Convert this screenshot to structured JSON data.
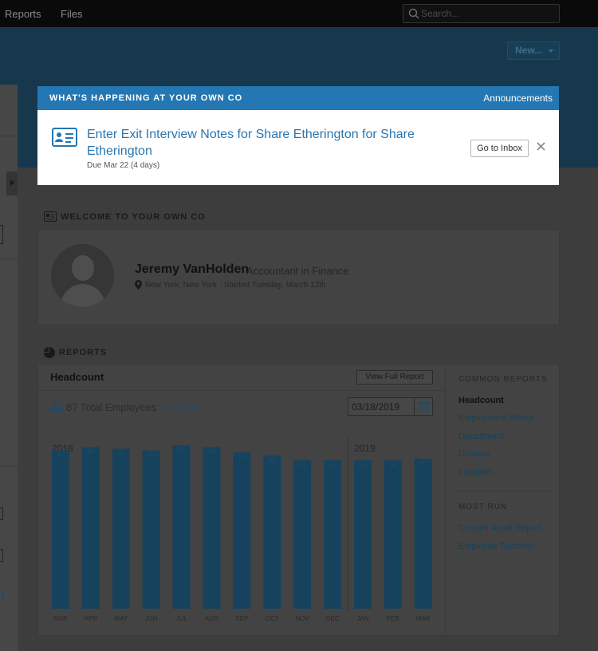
{
  "topnav": {
    "links": [
      "Reports",
      "Files"
    ],
    "search_placeholder": "Search..."
  },
  "header": {
    "new_button": "New..."
  },
  "welcome": {
    "section_title": "WELCOME TO YOUR OWN CO",
    "name": "Jeremy VanHolden",
    "title": "Accountant in Finance",
    "location": "New York, New York · Started Tuesday, March 12th"
  },
  "reports": {
    "section_title": "REPORTS",
    "card_title": "Headcount",
    "view_full_report": "View Full Report",
    "total_employees": "87 Total Employees",
    "ytd": "+ 1 YTD",
    "date_value": "03/18/2019",
    "year_left": "2018",
    "year_right": "2019"
  },
  "chart_data": {
    "type": "bar",
    "categories": [
      "MAR",
      "APR",
      "MAY",
      "JUN",
      "JUL",
      "AUG",
      "SEP",
      "OCT",
      "NOV",
      "DEC",
      "JAN",
      "FEB",
      "MAR"
    ],
    "values": [
      92,
      94,
      93,
      92,
      95,
      94,
      91,
      89,
      86,
      86,
      86,
      86,
      87
    ],
    "ylim": [
      0,
      100
    ],
    "colors": {
      "bar": "#17425e",
      "label": "#1f4b66"
    }
  },
  "common_reports": {
    "heading": "COMMON REPORTS",
    "items": [
      "Headcount",
      "Employment Status",
      "Department",
      "Division",
      "Location"
    ],
    "active": "Headcount"
  },
  "most_run": {
    "heading": "MOST RUN",
    "items": [
      "Custom Asset Report",
      "Employee Turnover"
    ]
  },
  "announcement": {
    "header_title": "WHAT'S HAPPENING AT YOUR OWN CO",
    "header_link": "Announcements",
    "task": "Enter Exit Interview Notes for Share Etherington for Share Etherington",
    "due": "Due Mar 22 (4 days)",
    "inbox_button": "Go to Inbox"
  },
  "colors": {
    "accent": "#2477b2",
    "nav": "#0a0a0a",
    "header": "#17384c"
  }
}
